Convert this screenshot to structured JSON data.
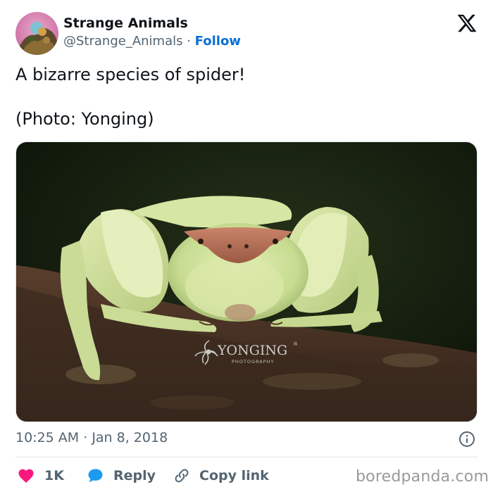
{
  "user": {
    "display_name": "Strange Animals",
    "handle": "@Strange_Animals",
    "separator": " · ",
    "follow_label": "Follow"
  },
  "tweet": {
    "line1": "A bizarre species of spider!",
    "line2": "(Photo: Yonging)"
  },
  "photo": {
    "watermark_name": "YONGING",
    "watermark_registered": "®",
    "watermark_sub": "PHOTOGRAPHY"
  },
  "meta": {
    "time": "10:25 AM",
    "separator": " · ",
    "date": "Jan 8, 2018"
  },
  "actions": {
    "like_count": "1K",
    "reply_label": "Reply",
    "copy_link_label": "Copy link"
  },
  "site_watermark": "boredpanda.com",
  "colors": {
    "follow_link": "#0a6fd6",
    "like_heart": "#f91880",
    "reply_bubble": "#1d9bf0",
    "secondary_text": "#536471",
    "photo_background": "#17200f"
  },
  "icons": {
    "brand": "x-logo-icon",
    "info": "info-icon",
    "like": "heart-icon",
    "reply": "speech-bubble-icon",
    "copy_link": "link-icon"
  }
}
